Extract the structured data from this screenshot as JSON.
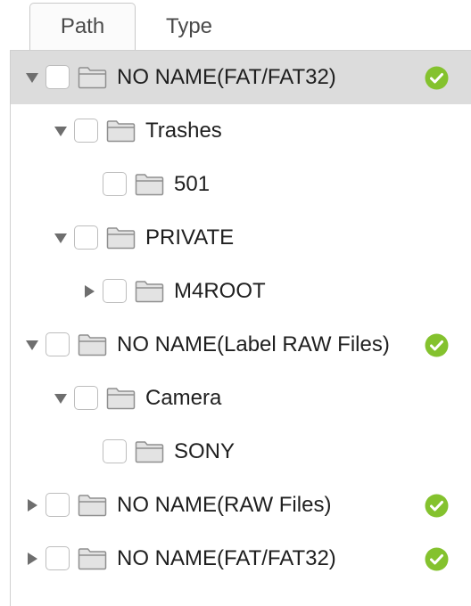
{
  "tabs": [
    {
      "label": "Path",
      "active": true
    },
    {
      "label": "Type",
      "active": false
    }
  ],
  "tree": [
    {
      "label": "NO NAME(FAT/FAT32)",
      "expander": "expanded",
      "status": "ok",
      "selected": true
    },
    {
      "label": "Trashes",
      "expander": "expanded"
    },
    {
      "label": "501",
      "expander": "none"
    },
    {
      "label": "PRIVATE",
      "expander": "expanded"
    },
    {
      "label": "M4ROOT",
      "expander": "collapsed"
    },
    {
      "label": "NO NAME(Label RAW Files)",
      "expander": "expanded",
      "status": "ok"
    },
    {
      "label": "Camera",
      "expander": "expanded"
    },
    {
      "label": "SONY",
      "expander": "none"
    },
    {
      "label": "NO NAME(RAW Files)",
      "expander": "collapsed",
      "status": "ok"
    },
    {
      "label": "NO NAME(FAT/FAT32)",
      "expander": "collapsed",
      "status": "ok"
    }
  ],
  "colors": {
    "selected_row": "#dcdcdc",
    "status_ok": "#84c22e",
    "folder": "#8f8f8f"
  },
  "icons": {
    "expanded": "triangle-down-icon",
    "collapsed": "triangle-right-icon",
    "folder": "folder-icon",
    "status": "check-circle-icon"
  }
}
